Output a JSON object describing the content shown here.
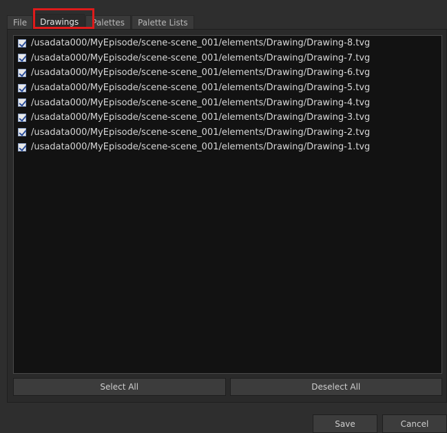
{
  "tabs": [
    {
      "label": "File"
    },
    {
      "label": "Drawings"
    },
    {
      "label": "Palettes"
    },
    {
      "label": "Palette Lists"
    }
  ],
  "active_tab": "Drawings",
  "highlight_color": "#e01b1b",
  "drawings": [
    {
      "path": "/usadata000/MyEpisode/scene-scene_001/elements/Drawing/Drawing-8.tvg",
      "checked": true
    },
    {
      "path": "/usadata000/MyEpisode/scene-scene_001/elements/Drawing/Drawing-7.tvg",
      "checked": true
    },
    {
      "path": "/usadata000/MyEpisode/scene-scene_001/elements/Drawing/Drawing-6.tvg",
      "checked": true
    },
    {
      "path": "/usadata000/MyEpisode/scene-scene_001/elements/Drawing/Drawing-5.tvg",
      "checked": true
    },
    {
      "path": "/usadata000/MyEpisode/scene-scene_001/elements/Drawing/Drawing-4.tvg",
      "checked": true
    },
    {
      "path": "/usadata000/MyEpisode/scene-scene_001/elements/Drawing/Drawing-3.tvg",
      "checked": true
    },
    {
      "path": "/usadata000/MyEpisode/scene-scene_001/elements/Drawing/Drawing-2.tvg",
      "checked": true
    },
    {
      "path": "/usadata000/MyEpisode/scene-scene_001/elements/Drawing/Drawing-1.tvg",
      "checked": true
    }
  ],
  "actions": {
    "select_all": "Select All",
    "deselect_all": "Deselect All"
  },
  "footer": {
    "save": "Save",
    "cancel": "Cancel"
  }
}
